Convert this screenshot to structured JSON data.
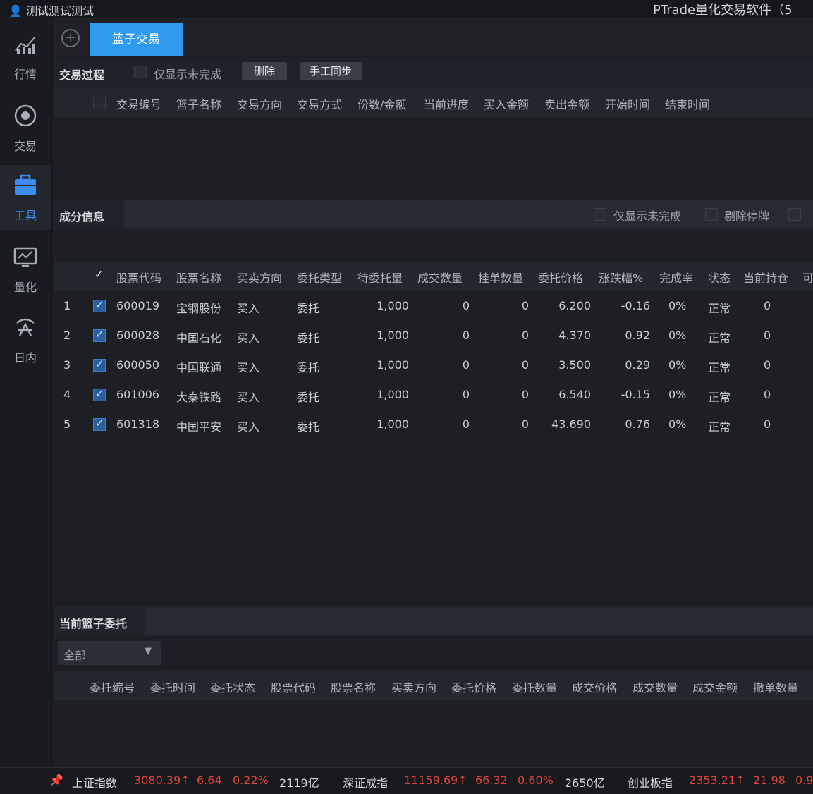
{
  "window": {
    "user": "测试测试测试",
    "app_title": "PTrade量化交易软件（5"
  },
  "sidebar": {
    "items": [
      {
        "label": "行情",
        "icon": "chart-icon"
      },
      {
        "label": "交易",
        "icon": "trade-icon"
      },
      {
        "label": "工具",
        "icon": "toolbox-icon",
        "active": true
      },
      {
        "label": "量化",
        "icon": "monitor-chart-icon"
      },
      {
        "label": "日内",
        "icon": "intraday-icon"
      }
    ]
  },
  "tabs": {
    "add_label": "+",
    "active_label": "篮子交易"
  },
  "process": {
    "title": "交易过程",
    "only_unfinished": "仅显示未完成",
    "delete_button": "删除",
    "sync_button": "手工同步",
    "columns": [
      "交易编号",
      "篮子名称",
      "交易方向",
      "交易方式",
      "份数/金额",
      "当前进度",
      "买入金额",
      "卖出金额",
      "开始时间",
      "结束时间"
    ]
  },
  "components": {
    "title": "成分信息",
    "only_unfinished": "仅显示未完成",
    "remove_suspended": "剔除停牌",
    "columns": [
      "股票代码",
      "股票名称",
      "买卖方向",
      "委托类型",
      "待委托量",
      "成交数量",
      "挂单数量",
      "委托价格",
      "涨跌幅%",
      "完成率",
      "状态",
      "当前持仓",
      "可"
    ],
    "rows": [
      {
        "no": "1",
        "code": "600019",
        "name": "宝钢股份",
        "dir": "买入",
        "type": "委托",
        "pending": "1,000",
        "filled": "0",
        "queued": "0",
        "price": "6.200",
        "change": "-0.16",
        "rate": "0%",
        "status": "正常",
        "holding": "0"
      },
      {
        "no": "2",
        "code": "600028",
        "name": "中国石化",
        "dir": "买入",
        "type": "委托",
        "pending": "1,000",
        "filled": "0",
        "queued": "0",
        "price": "4.370",
        "change": "0.92",
        "rate": "0%",
        "status": "正常",
        "holding": "0"
      },
      {
        "no": "3",
        "code": "600050",
        "name": "中国联通",
        "dir": "买入",
        "type": "委托",
        "pending": "1,000",
        "filled": "0",
        "queued": "0",
        "price": "3.500",
        "change": "0.29",
        "rate": "0%",
        "status": "正常",
        "holding": "0"
      },
      {
        "no": "4",
        "code": "601006",
        "name": "大秦铁路",
        "dir": "买入",
        "type": "委托",
        "pending": "1,000",
        "filled": "0",
        "queued": "0",
        "price": "6.540",
        "change": "-0.15",
        "rate": "0%",
        "status": "正常",
        "holding": "0"
      },
      {
        "no": "5",
        "code": "601318",
        "name": "中国平安",
        "dir": "买入",
        "type": "委托",
        "pending": "1,000",
        "filled": "0",
        "queued": "0",
        "price": "43.690",
        "change": "0.76",
        "rate": "0%",
        "status": "正常",
        "holding": "0"
      }
    ]
  },
  "orders": {
    "title": "当前篮子委托",
    "filter_value": "全部",
    "columns": [
      "委托编号",
      "委托时间",
      "委托状态",
      "股票代码",
      "股票名称",
      "买卖方向",
      "委托价格",
      "委托数量",
      "成交价格",
      "成交数量",
      "成交金额",
      "撤单数量"
    ]
  },
  "statusbar": {
    "indices": [
      {
        "name": "上证指数",
        "value": "3080.39↑",
        "change": "6.64",
        "pct": "0.22%",
        "volume": "2119亿"
      },
      {
        "name": "深证成指",
        "value": "11159.69↑",
        "change": "66.32",
        "pct": "0.60%",
        "volume": "2650亿"
      },
      {
        "name": "创业板指",
        "value": "2353.21↑",
        "change": "21.98",
        "pct": "0.9"
      }
    ]
  },
  "colors": {
    "accent": "#2f9bf0",
    "up": "#e0443b",
    "bg": "#1c1e24"
  }
}
